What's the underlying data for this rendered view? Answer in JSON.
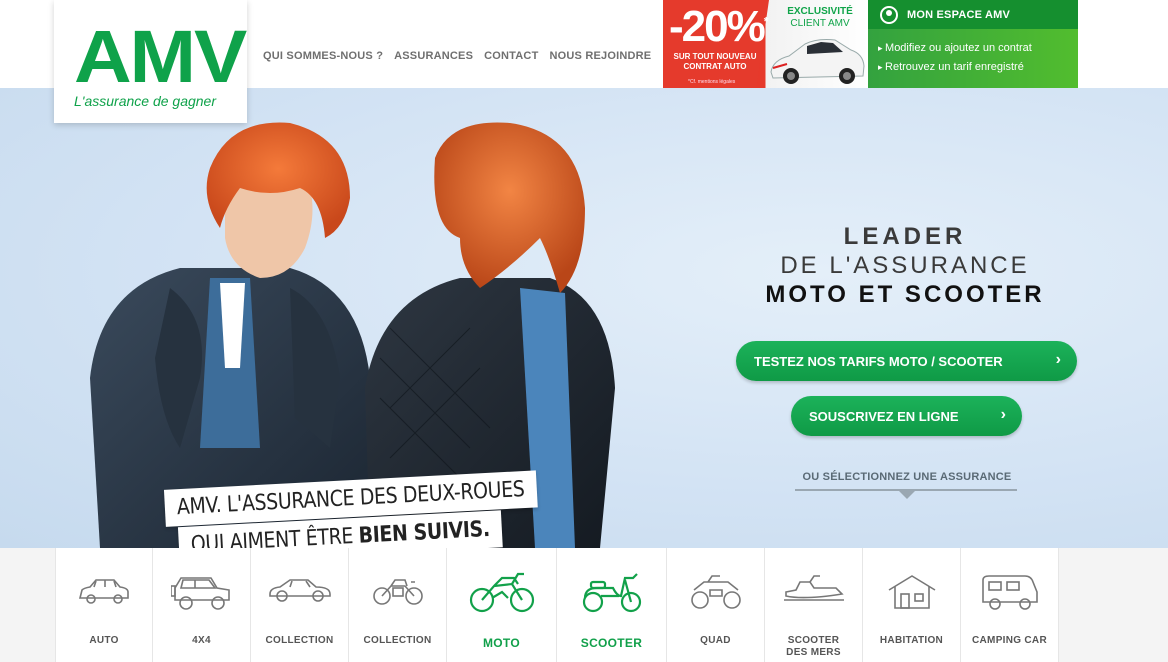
{
  "brand": {
    "name": "AMV",
    "tagline": "L'assurance de gagner",
    "green": "#0fa24a"
  },
  "nav": {
    "items": [
      "QUI SOMMES-NOUS ?",
      "ASSURANCES",
      "CONTACT",
      "NOUS REJOINDRE"
    ]
  },
  "promo": {
    "discount": "-20%",
    "asterisk": "*",
    "line1": "SUR TOUT NOUVEAU",
    "line2": "CONTRAT AUTO",
    "mention": "*Cf. mentions légales",
    "exclusivite": "EXCLUSIVITÉ",
    "client": "CLIENT AMV"
  },
  "espace": {
    "title": "MON ESPACE AMV",
    "links": [
      "Modifiez ou ajoutez un contrat",
      "Retrouvez un tarif enregistré"
    ]
  },
  "hero": {
    "slogan_line1": "AMV. L'ASSURANCE DES DEUX-ROUES",
    "slogan_line2_start": "QUI AIMENT ÊTRE ",
    "slogan_line2_bold": "BIEN SUIVIS.",
    "lead1": "LEADER",
    "lead2": "DE L'ASSURANCE",
    "lead3": "MOTO ET SCOOTER",
    "btn_tarif": "TESTEZ NOS TARIFS MOTO / SCOOTER",
    "btn_souscrire": "SOUSCRIVEZ EN LIGNE",
    "select_label": "OU SÉLECTIONNEZ UNE ASSURANCE"
  },
  "insurances": [
    {
      "label": "AUTO",
      "icon": "car-icon",
      "active": false
    },
    {
      "label": "4X4",
      "icon": "4x4-icon",
      "active": false
    },
    {
      "label": "COLLECTION",
      "icon": "classic-car-icon",
      "active": false
    },
    {
      "label": "COLLECTION",
      "icon": "classic-motorbike-icon",
      "active": false
    },
    {
      "label": "MOTO",
      "icon": "motorbike-icon",
      "active": true
    },
    {
      "label": "SCOOTER",
      "icon": "scooter-icon",
      "active": true
    },
    {
      "label": "QUAD",
      "icon": "quad-icon",
      "active": false
    },
    {
      "label": "SCOOTER",
      "label2": "DES MERS",
      "icon": "jetski-icon",
      "active": false
    },
    {
      "label": "HABITATION",
      "icon": "house-icon",
      "active": false
    },
    {
      "label": "CAMPING CAR",
      "icon": "camper-icon",
      "active": false
    }
  ]
}
